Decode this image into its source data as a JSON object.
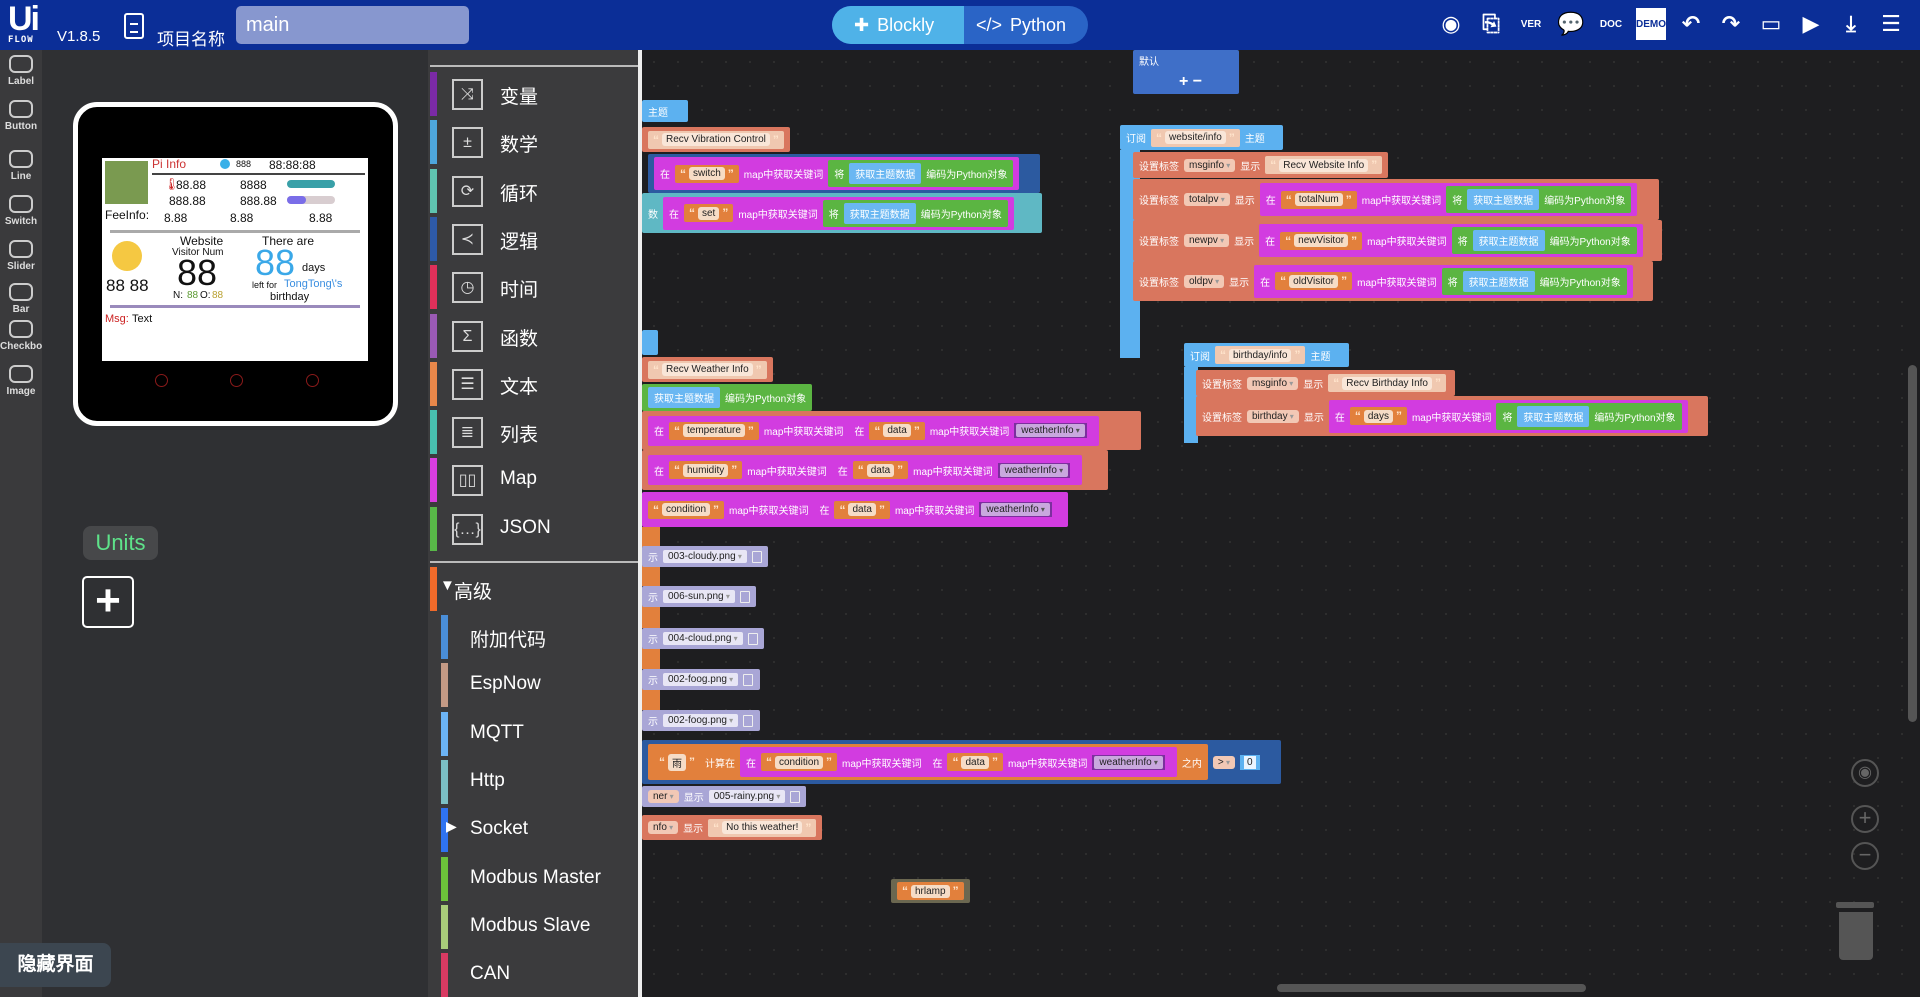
{
  "topbar": {
    "logo": "Ui FLOW",
    "logo_main": "Ui",
    "logo_sub": "FLOW",
    "version": "V1.8.5",
    "project_label": "项目名称",
    "project_name": "main",
    "mode_blockly": "Blockly",
    "mode_python": "Python",
    "tools": [
      {
        "name": "firmware-icon",
        "glyph": "◉"
      },
      {
        "name": "new-file-icon",
        "glyph": "⎘"
      },
      {
        "name": "version-icon",
        "glyph": "VER"
      },
      {
        "name": "comment-icon",
        "glyph": "💬"
      },
      {
        "name": "doc-icon",
        "glyph": "DOC"
      },
      {
        "name": "demo-icon",
        "glyph": "DEMO"
      },
      {
        "name": "undo-icon",
        "glyph": "↶"
      },
      {
        "name": "redo-icon",
        "glyph": "↷"
      },
      {
        "name": "device-icon",
        "glyph": "▭"
      },
      {
        "name": "run-icon",
        "glyph": "▶"
      },
      {
        "name": "download-icon",
        "glyph": "⤓"
      },
      {
        "name": "menu-icon",
        "glyph": "☰"
      }
    ]
  },
  "widgets": [
    "Label",
    "Button",
    "Line",
    "Switch",
    "Slider",
    "Bar",
    "Checkbox",
    "Image"
  ],
  "device": {
    "title": "Pi Info",
    "bat": "888",
    "time": "88:88:88",
    "temp": "88.88",
    "hum": "8888",
    "cpu": "888.88",
    "clock": "888.88",
    "fee_label": "FeeInfo:",
    "fee1": "8.88",
    "fee2": "8.88",
    "fee3": "8.88",
    "weather_val": "88 88",
    "website": "Website",
    "visitor_num": "Visitor  Num",
    "visitors": "88",
    "n_label": "N:",
    "n_val": "88",
    "o_label": "O:",
    "o_val": "88",
    "there_are": "There are",
    "days_num": "88",
    "days": "days",
    "left_for": "left for",
    "name": "TongTong\\'s",
    "birthday": "birthday",
    "msg_label": "Msg:",
    "msg_text": "Text"
  },
  "units_label": "Units",
  "hide_ui": "隐藏界面",
  "categories": [
    {
      "label": "变量",
      "color": "#7b2aa6",
      "icon": "⤨"
    },
    {
      "label": "数学",
      "color": "#4ea6dc",
      "icon": "±"
    },
    {
      "label": "循环",
      "color": "#5fc4b0",
      "icon": "⟳"
    },
    {
      "label": "逻辑",
      "color": "#2e5aa8",
      "icon": "≺"
    },
    {
      "label": "时间",
      "color": "#e0305a",
      "icon": "◷"
    },
    {
      "label": "函数",
      "color": "#9a5ab5",
      "icon": "Σ"
    },
    {
      "label": "文本",
      "color": "#e8874a",
      "icon": "☰"
    },
    {
      "label": "列表",
      "color": "#48bfaf",
      "icon": "≣"
    },
    {
      "label": "Map",
      "color": "#d93ee0",
      "icon": "▯▯"
    },
    {
      "label": "JSON",
      "color": "#58b848",
      "icon": "{…}"
    }
  ],
  "advanced": {
    "label": "高级",
    "color": "#f06a2a",
    "items": [
      {
        "label": "附加代码",
        "color": "#4a8ed8"
      },
      {
        "label": "EspNow",
        "color": "#c49a85"
      },
      {
        "label": "MQTT",
        "color": "#6cb4f5"
      },
      {
        "label": "Http",
        "color": "#7bbfc4"
      },
      {
        "label": "Socket",
        "color": "#2f73f0",
        "arrow": "▶"
      },
      {
        "label": "Modbus Master",
        "color": "#6cc33a"
      },
      {
        "label": "Modbus Slave",
        "color": "#a8cc7a"
      },
      {
        "label": "CAN",
        "color": "#d83a62"
      }
    ]
  },
  "colors": {
    "topbar": "#0b2e97",
    "salmon": "#d9765e",
    "magenta": "#d23ce0",
    "green": "#5bb542",
    "lightblue": "#5cb1f0",
    "orange": "#e2803c",
    "lavender": "#a9a6d6"
  },
  "blocks": [
    {
      "c": "#5cb1f0",
      "t": [
        {
          "k": "kw",
          "v": "主题"
        }
      ]
    },
    {
      "c": "#d9765e",
      "t": [
        {
          "k": "strl",
          "v": "Recv Vibration Control"
        }
      ]
    },
    {
      "c": "#2c5aa0",
      "t": [
        {
          "k": "grp",
          "c": "#d23ce0",
          "t": [
            {
              "k": "kw",
              "v": "在"
            },
            {
              "k": "str",
              "v": "switch"
            },
            {
              "k": "kw",
              "v": "map中获取关键词"
            },
            {
              "k": "grp",
              "c": "#5bb542",
              "t": [
                {
                  "k": "kw",
                  "v": "将"
                },
                {
                  "k": "get",
                  "v": "获取主题数据"
                },
                {
                  "k": "kw",
                  "v": "编码为Python对象"
                }
              ]
            }
          ]
        }
      ]
    },
    {
      "c": "#5fb8c4",
      "t": [
        {
          "k": "kw",
          "v": "数"
        },
        {
          "k": "grp",
          "c": "#d23ce0",
          "t": [
            {
              "k": "kw",
              "v": "在"
            },
            {
              "k": "str",
              "v": "set"
            },
            {
              "k": "kw",
              "v": "map中获取关键词"
            },
            {
              "k": "grp",
              "c": "#5bb542",
              "t": [
                {
                  "k": "kw",
                  "v": "将"
                },
                {
                  "k": "get",
                  "v": "获取主题数据"
                },
                {
                  "k": "kw",
                  "v": "编码为Python对象"
                }
              ]
            }
          ]
        }
      ]
    },
    {
      "c": "#5cb1f0",
      "t": []
    },
    {
      "c": "#d9765e",
      "t": [
        {
          "k": "strl",
          "v": "Recv Weather Info"
        }
      ]
    },
    {
      "c": "#5bb542",
      "t": [
        {
          "k": "get",
          "v": "获取主题数据"
        },
        {
          "k": "kw",
          "v": "编码为Python对象"
        }
      ]
    },
    {
      "c": "#d9765e",
      "t": [
        {
          "k": "grp",
          "c": "#d23ce0",
          "t": [
            {
              "k": "kw",
              "v": "在"
            },
            {
              "k": "str",
              "v": "temperature"
            },
            {
              "k": "kw",
              "v": "map中获取关键词"
            },
            {
              "k": "grp",
              "c": "#d23ce0",
              "t": [
                {
                  "k": "kw",
                  "v": "在"
                },
                {
                  "k": "str",
                  "v": "data"
                },
                {
                  "k": "kw",
                  "v": "map中获取关键词"
                },
                {
                  "k": "var",
                  "v": "weatherInfo"
                }
              ]
            }
          ]
        }
      ]
    },
    {
      "c": "#d9765e",
      "t": [
        {
          "k": "grp",
          "c": "#d23ce0",
          "t": [
            {
              "k": "kw",
              "v": "在"
            },
            {
              "k": "str",
              "v": "humidity"
            },
            {
              "k": "kw",
              "v": "map中获取关键词"
            },
            {
              "k": "grp",
              "c": "#d23ce0",
              "t": [
                {
                  "k": "kw",
                  "v": "在"
                },
                {
                  "k": "str",
                  "v": "data"
                },
                {
                  "k": "kw",
                  "v": "map中获取关键词"
                },
                {
                  "k": "var",
                  "v": "weatherInfo"
                }
              ]
            }
          ]
        }
      ]
    },
    {
      "c": "#d23ce0",
      "t": [
        {
          "k": "str",
          "v": "condition"
        },
        {
          "k": "kw",
          "v": "map中获取关键词"
        },
        {
          "k": "grp",
          "c": "#d23ce0",
          "t": [
            {
              "k": "kw",
              "v": "在"
            },
            {
              "k": "str",
              "v": "data"
            },
            {
              "k": "kw",
              "v": "map中获取关键词"
            },
            {
              "k": "var",
              "v": "weatherInfo"
            }
          ]
        }
      ]
    },
    {
      "c": "#a9a6d6",
      "t": [
        {
          "k": "kw",
          "v": "示"
        },
        {
          "k": "file",
          "v": "003-cloudy.png"
        }
      ]
    },
    {
      "c": "#a9a6d6",
      "t": [
        {
          "k": "kw",
          "v": "示"
        },
        {
          "k": "file",
          "v": "006-sun.png"
        }
      ]
    },
    {
      "c": "#a9a6d6",
      "t": [
        {
          "k": "kw",
          "v": "示"
        },
        {
          "k": "file",
          "v": "004-cloud.png"
        }
      ]
    },
    {
      "c": "#a9a6d6",
      "t": [
        {
          "k": "kw",
          "v": "示"
        },
        {
          "k": "file",
          "v": "002-foog.png"
        }
      ]
    },
    {
      "c": "#a9a6d6",
      "t": [
        {
          "k": "kw",
          "v": "示"
        },
        {
          "k": "file",
          "v": "002-foog.png"
        }
      ]
    },
    {
      "c": "#2c5aa0",
      "t": [
        {
          "k": "grp",
          "c": "#e2803c",
          "t": [
            {
              "k": "str",
              "v": "雨"
            },
            {
              "k": "kw",
              "v": "计算在"
            },
            {
              "k": "grp",
              "c": "#d23ce0",
              "t": [
                {
                  "k": "kw",
                  "v": "在"
                },
                {
                  "k": "str",
                  "v": "condition"
                },
                {
                  "k": "kw",
                  "v": "map中获取关键词"
                },
                {
                  "k": "grp",
                  "c": "#d23ce0",
                  "t": [
                    {
                      "k": "kw",
                      "v": "在"
                    },
                    {
                      "k": "str",
                      "v": "data"
                    },
                    {
                      "k": "kw",
                      "v": "map中获取关键词"
                    },
                    {
                      "k": "var",
                      "v": "weatherInfo"
                    }
                  ]
                }
              ]
            },
            {
              "k": "kw",
              "v": "之内"
            }
          ]
        },
        {
          "k": "dd",
          "v": ">"
        },
        {
          "k": "num",
          "v": "0"
        }
      ]
    },
    {
      "c": "#a9a6d6",
      "t": [
        {
          "k": "dd",
          "v": "ner"
        },
        {
          "k": "kw",
          "v": "显示"
        },
        {
          "k": "file",
          "v": "005-rainy.png"
        }
      ]
    },
    {
      "c": "#d9765e",
      "t": [
        {
          "k": "dd",
          "v": "nfo"
        },
        {
          "k": "kw",
          "v": "显示"
        },
        {
          "k": "strl",
          "v": "No this weather!"
        }
      ]
    },
    {
      "c": "#6b6750",
      "t": [
        {
          "k": "str",
          "v": "hrlamp"
        }
      ]
    },
    {
      "c": "#3f6fc8",
      "t": [
        {
          "k": "kw",
          "v": "默认"
        }
      ]
    },
    {
      "c": "#5cb1f0",
      "t": [
        {
          "k": "kw",
          "v": "订阅"
        },
        {
          "k": "strl",
          "v": "website/info"
        },
        {
          "k": "kw",
          "v": "主题"
        }
      ]
    },
    {
      "c": "#d9765e",
      "t": [
        {
          "k": "kw",
          "v": "设置标签"
        },
        {
          "k": "dd",
          "v": "msginfo"
        },
        {
          "k": "kw",
          "v": "显示"
        },
        {
          "k": "strl",
          "v": "Recv Website Info"
        }
      ]
    },
    {
      "c": "#d9765e",
      "t": [
        {
          "k": "kw",
          "v": "设置标签"
        },
        {
          "k": "dd",
          "v": "totalpv"
        },
        {
          "k": "kw",
          "v": "显示"
        },
        {
          "k": "grp",
          "c": "#d23ce0",
          "t": [
            {
              "k": "kw",
              "v": "在"
            },
            {
              "k": "str",
              "v": "totalNum"
            },
            {
              "k": "kw",
              "v": "map中获取关键词"
            },
            {
              "k": "grp",
              "c": "#5bb542",
              "t": [
                {
                  "k": "kw",
                  "v": "将"
                },
                {
                  "k": "get",
                  "v": "获取主题数据"
                },
                {
                  "k": "kw",
                  "v": "编码为Python对象"
                }
              ]
            }
          ]
        }
      ]
    },
    {
      "c": "#d9765e",
      "t": [
        {
          "k": "kw",
          "v": "设置标签"
        },
        {
          "k": "dd",
          "v": "newpv"
        },
        {
          "k": "kw",
          "v": "显示"
        },
        {
          "k": "grp",
          "c": "#d23ce0",
          "t": [
            {
              "k": "kw",
              "v": "在"
            },
            {
              "k": "str",
              "v": "newVisitor"
            },
            {
              "k": "kw",
              "v": "map中获取关键词"
            },
            {
              "k": "grp",
              "c": "#5bb542",
              "t": [
                {
                  "k": "kw",
                  "v": "将"
                },
                {
                  "k": "get",
                  "v": "获取主题数据"
                },
                {
                  "k": "kw",
                  "v": "编码为Python对象"
                }
              ]
            }
          ]
        }
      ]
    },
    {
      "c": "#d9765e",
      "t": [
        {
          "k": "kw",
          "v": "设置标签"
        },
        {
          "k": "dd",
          "v": "oldpv"
        },
        {
          "k": "kw",
          "v": "显示"
        },
        {
          "k": "grp",
          "c": "#d23ce0",
          "t": [
            {
              "k": "kw",
              "v": "在"
            },
            {
              "k": "str",
              "v": "oldVisitor"
            },
            {
              "k": "kw",
              "v": "map中获取关键词"
            },
            {
              "k": "grp",
              "c": "#5bb542",
              "t": [
                {
                  "k": "kw",
                  "v": "将"
                },
                {
                  "k": "get",
                  "v": "获取主题数据"
                },
                {
                  "k": "kw",
                  "v": "编码为Python对象"
                }
              ]
            }
          ]
        }
      ]
    },
    {
      "c": "#5cb1f0",
      "t": [
        {
          "k": "kw",
          "v": "订阅"
        },
        {
          "k": "strl",
          "v": "birthday/info"
        },
        {
          "k": "kw",
          "v": "主题"
        }
      ]
    },
    {
      "c": "#d9765e",
      "t": [
        {
          "k": "kw",
          "v": "设置标签"
        },
        {
          "k": "dd",
          "v": "msginfo"
        },
        {
          "k": "kw",
          "v": "显示"
        },
        {
          "k": "strl",
          "v": "Recv Birthday Info"
        }
      ]
    },
    {
      "c": "#d9765e",
      "t": [
        {
          "k": "kw",
          "v": "设置标签"
        },
        {
          "k": "dd",
          "v": "birthday"
        },
        {
          "k": "kw",
          "v": "显示"
        },
        {
          "k": "grp",
          "c": "#d23ce0",
          "t": [
            {
              "k": "kw",
              "v": "在"
            },
            {
              "k": "str",
              "v": "days"
            },
            {
              "k": "kw",
              "v": "map中获取关键词"
            },
            {
              "k": "grp",
              "c": "#5bb542",
              "t": [
                {
                  "k": "kw",
                  "v": "将"
                },
                {
                  "k": "get",
                  "v": "获取主题数据"
                },
                {
                  "k": "kw",
                  "v": "编码为Python对象"
                }
              ]
            }
          ]
        }
      ]
    }
  ],
  "default_controls": "+ −"
}
